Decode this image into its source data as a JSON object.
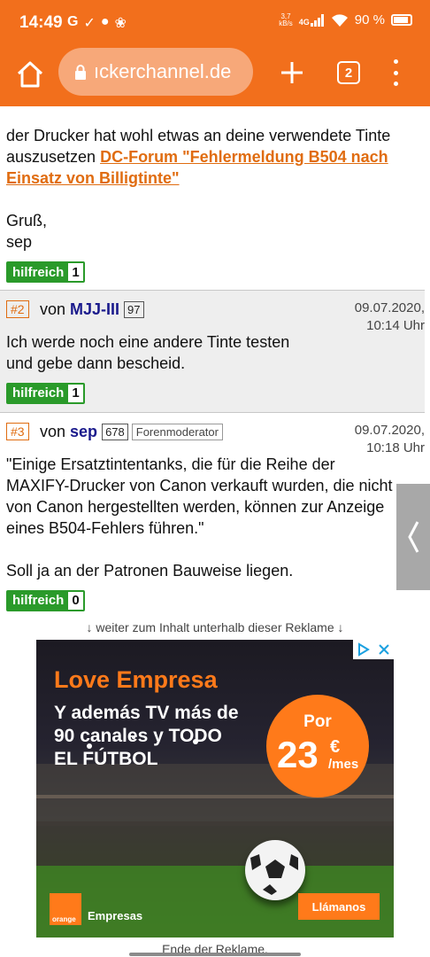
{
  "status_bar": {
    "time": "14:49",
    "left_icons": [
      "G",
      "✓",
      "●",
      "❀"
    ],
    "speed_top": "3,7",
    "speed_bottom": "kB/s",
    "network": "4G",
    "battery": "90 %"
  },
  "browser": {
    "url": "ıckerchannel.de",
    "tab_count": "2",
    "accent": "#f26f1c"
  },
  "post1_tail": {
    "text_before_link": "der Drucker hat wohl etwas an deine verwendete Tinte auszusetzen ",
    "link": "DC-Forum \"Fehlermeldung B504 nach Einsatz von Billigtinte\"",
    "greeting": "Gruß,",
    "signature": "sep",
    "helpful_label": "hilfreich",
    "helpful_count": "1"
  },
  "posts": [
    {
      "number": "#2",
      "von": "von",
      "user": "MJJ-III",
      "post_count": "97",
      "role": "",
      "date": "09.07.2020,",
      "time": "10:14 Uhr",
      "body": "Ich werde noch eine andere Tinte testen und gebe dann bescheid.",
      "helpful_label": "hilfreich",
      "helpful_count": "1"
    },
    {
      "number": "#3",
      "von": "von",
      "user": "sep",
      "post_count": "678",
      "role": "Forenmoderator",
      "date": "09.07.2020,",
      "time": "10:18 Uhr",
      "body_quote": "\"Einige Ersatztintentanks, die für die Reihe der MAXIFY-Drucker von Canon verkauft wurden, die nicht von Canon hergestellten werden, können zur Anzeige eines B504-Fehlers führen.\"",
      "body_extra": "Soll ja an der Patronen Bauweise liegen.",
      "helpful_label": "hilfreich",
      "helpful_count": "0"
    }
  ],
  "ad": {
    "note_top": "↓ weiter zum Inhalt unterhalb dieser Reklame ↓",
    "title": "Love Empresa",
    "subtitle": "Y además TV más de 90 canales y TODO EL FÚTBOL",
    "por": "Por",
    "price": "23",
    "currency": "€",
    "per": "/mes",
    "brand_logo": "orange",
    "brand": "Empresas",
    "cta": "Llámanos",
    "note_bottom": "Ende der Reklame."
  }
}
